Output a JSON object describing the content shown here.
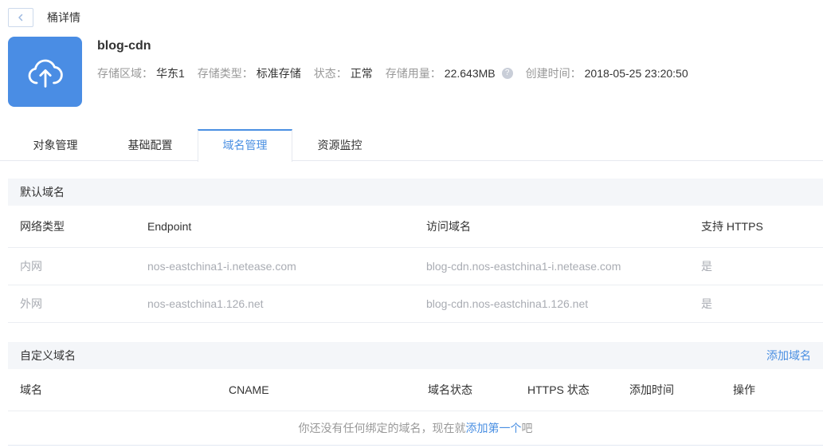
{
  "page": {
    "title": "桶详情"
  },
  "colors": {
    "accent": "#4a8fe2",
    "icon_bg": "#4a8de4",
    "section_bg": "#f4f6f9"
  },
  "icons": {
    "help_glyph": "?"
  },
  "bucket": {
    "name": "blog-cdn",
    "meta": [
      {
        "label": "存储区域：",
        "value": "华东1"
      },
      {
        "label": "存储类型：",
        "value": "标准存储"
      },
      {
        "label": "状态：",
        "value": "正常"
      },
      {
        "label": "存储用量：",
        "value": "22.643MB"
      },
      {
        "label": "创建时间：",
        "value": "2018-05-25 23:20:50"
      }
    ]
  },
  "tabs": [
    {
      "label": "对象管理",
      "active": false
    },
    {
      "label": "基础配置",
      "active": false
    },
    {
      "label": "域名管理",
      "active": true
    },
    {
      "label": "资源监控",
      "active": false
    }
  ],
  "default_domain": {
    "title": "默认域名",
    "columns": [
      "网络类型",
      "Endpoint",
      "访问域名",
      "支持 HTTPS"
    ],
    "rows": [
      [
        "内网",
        "nos-eastchina1-i.netease.com",
        "blog-cdn.nos-eastchina1-i.netease.com",
        "是"
      ],
      [
        "外网",
        "nos-eastchina1.126.net",
        "blog-cdn.nos-eastchina1.126.net",
        "是"
      ]
    ]
  },
  "custom_domain": {
    "title": "自定义域名",
    "add_button": "添加域名",
    "columns": [
      "域名",
      "CNAME",
      "域名状态",
      "HTTPS 状态",
      "添加时间",
      "操作"
    ],
    "empty_state": {
      "text_before": "你还没有任何绑定的域名，现在就",
      "link": "添加第一个",
      "text_after": "吧"
    }
  }
}
